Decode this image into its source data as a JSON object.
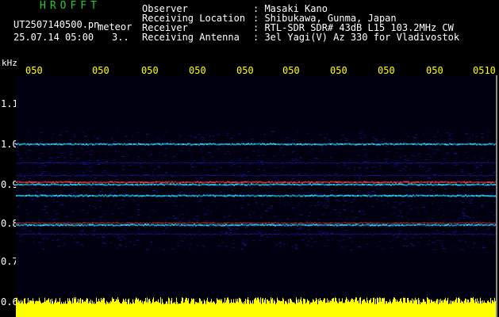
{
  "header": {
    "program_title": "HROFFT",
    "file_name": "UT2507140500.pn",
    "meteor_label": "meteor",
    "date_time": "25.07.14 05:00",
    "count_value": "3..",
    "info_rows": [
      {
        "key": "Observer",
        "value": ": Masaki Kano"
      },
      {
        "key": "Receiving Location",
        "value": ": Shibukawa, Gunma, Japan"
      },
      {
        "key": "Receiver",
        "value": ": RTL-SDR SDR# 43dB L15 103.2MHz CW"
      },
      {
        "key": "Receiving Antenna",
        "value": ": 3el Yagi(V) Az 330 for Vladivostok"
      }
    ]
  },
  "axes": {
    "y_unit": "kHz",
    "y_labels": [
      "1.1",
      "1.0",
      "0.9",
      "0.8",
      "0.7",
      "0.6"
    ],
    "time_ticks": [
      "050",
      "050",
      "050",
      "050",
      "050",
      "050",
      "050",
      "050",
      "050",
      "0510"
    ]
  },
  "colors": {
    "background": "#000000",
    "title_green": "#22cc22",
    "time_tick_yellow": "#ffff00",
    "amplitude_yellow": "#ffff00",
    "noise_blue": "#1a1aa0",
    "line_cyan": "#22d6ff",
    "line_red": "#ff3a3a"
  }
}
